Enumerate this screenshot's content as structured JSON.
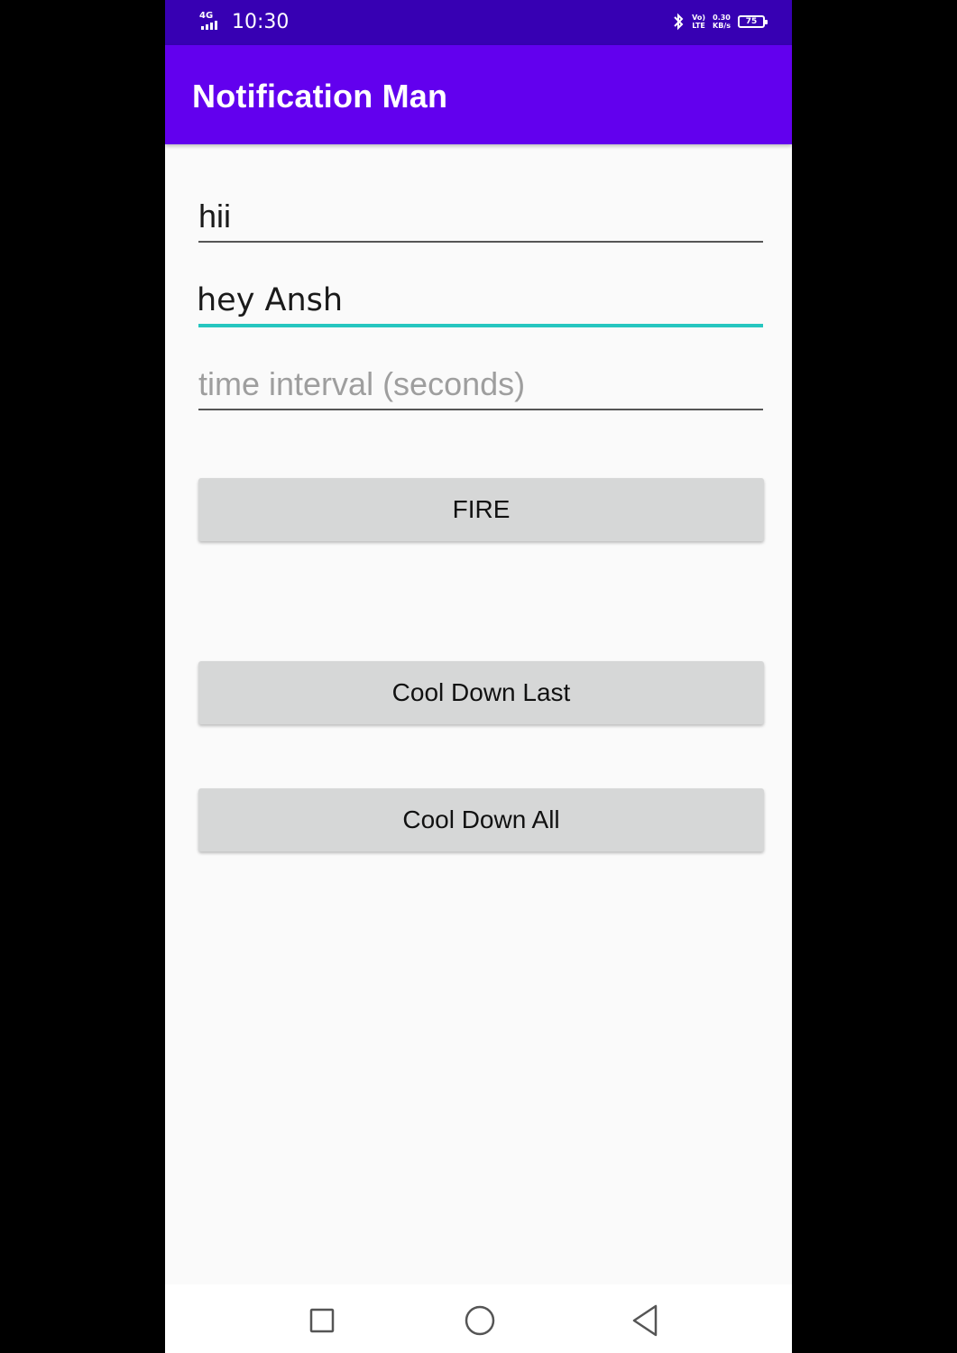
{
  "status_bar": {
    "network": "4G",
    "time": "10:30",
    "volte_top": "Vo)",
    "volte_bottom": "LTE",
    "speed_value": "0.30",
    "speed_unit": "KB/s",
    "battery": "75"
  },
  "app_bar": {
    "title": "Notification Man",
    "color": "#6200ee"
  },
  "form": {
    "title_field": {
      "value": "hii"
    },
    "message_field": {
      "value": "hey Ansh"
    },
    "interval_field": {
      "value": "",
      "placeholder": "time interval (seconds)"
    }
  },
  "buttons": {
    "fire": "FIRE",
    "cool_down_last": "Cool Down Last",
    "cool_down_all": "Cool Down All"
  },
  "nav_bar": {
    "icons": [
      "recents-icon",
      "home-icon",
      "back-icon"
    ]
  },
  "colors": {
    "status_bar": "#3700b3",
    "accent": "#26c6c0",
    "button_bg": "#d6d7d7"
  }
}
